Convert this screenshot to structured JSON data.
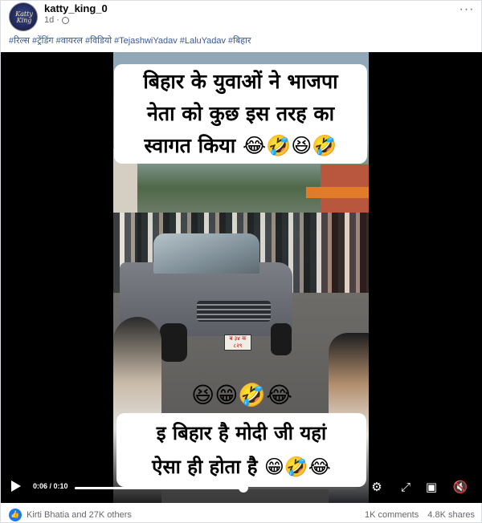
{
  "post": {
    "author": "katty_king_0",
    "avatar_text": "Katty King",
    "time": "1d",
    "more_icon": "more-dots-icon",
    "privacy_icon": "globe-icon",
    "hashtags": [
      "#रिल्स",
      "#ट्रेंडिंग",
      "#वायरल",
      "#विडियो",
      "#TejashwiYadav",
      "#LaluYadav",
      "#बिहार"
    ]
  },
  "video": {
    "caption_top": [
      "बिहार के युवाओं ने भाजपा",
      "नेता को कुछ इस तरह का",
      "स्वागत किया 😂🤣😆🤣"
    ],
    "emoji_row": "😆😁🤣😂",
    "caption_bottom": [
      "इ बिहार है मोदी जी यहां",
      "ऐसा ही होता है 😁🤣😂"
    ],
    "plate_text": "ब ३४ क ८२९",
    "current_time": "0:06",
    "duration": "0:10",
    "time_display": "0:06 / 0:10",
    "progress": 0.6,
    "icons": {
      "play": "play-icon",
      "settings": "gear-icon",
      "fullscreen": "expand-icon",
      "pip": "picture-in-picture-icon",
      "volume": "volume-muted-icon"
    }
  },
  "footer": {
    "reactions_text": "Kirti Bhatia and 27K others",
    "comments_text": "1K comments",
    "shares_text": "4.8K shares"
  },
  "colors": {
    "link_blue": "#385898",
    "like_blue": "#1877f2",
    "muted_gray": "#65676b"
  }
}
